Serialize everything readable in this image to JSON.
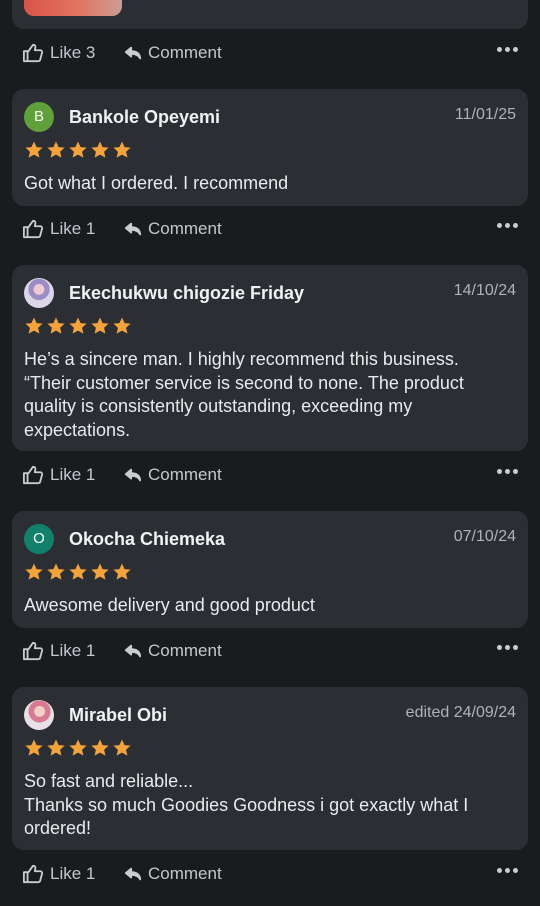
{
  "reviews": [
    {
      "name": "Bankole Opeyemi",
      "initial": "B",
      "date": "11/01/25",
      "text": [
        "Got what I ordered. I recommend"
      ],
      "likes": "Like 1",
      "stars": 5
    },
    {
      "name": "Ekechukwu chigozie Friday",
      "initial": "",
      "date": "14/10/24",
      "text": [
        "He’s a sincere man. I highly recommend this business.",
        "“Their customer service is second to none. The product",
        "quality is consistently outstanding, exceeding my",
        "expectations."
      ],
      "likes": "Like 1",
      "stars": 5
    },
    {
      "name": "Okocha Chiemeka",
      "initial": "O",
      "date": "07/10/24",
      "text": [
        "Awesome delivery and good product"
      ],
      "likes": "Like 1",
      "stars": 5
    },
    {
      "name": "Mirabel Obi",
      "initial": "",
      "date": "edited 24/09/24",
      "text": [
        "So fast and reliable...",
        "Thanks so much Goodies Goodness i got exactly what I",
        "ordered!"
      ],
      "likes": "Like 1",
      "stars": 5
    }
  ],
  "top_actions": {
    "likes": "Like 3"
  },
  "comment_label": "Comment",
  "icons": {
    "like": "thumbs-up-icon",
    "comment": "reply-arrow-icon",
    "more": "more-options-icon",
    "star": "star-icon"
  },
  "colors": {
    "background": "#181c1f",
    "card": "#2b2f34",
    "star": "#f6a23b",
    "avatar_green": "#5fa03b",
    "avatar_teal": "#12816b"
  }
}
